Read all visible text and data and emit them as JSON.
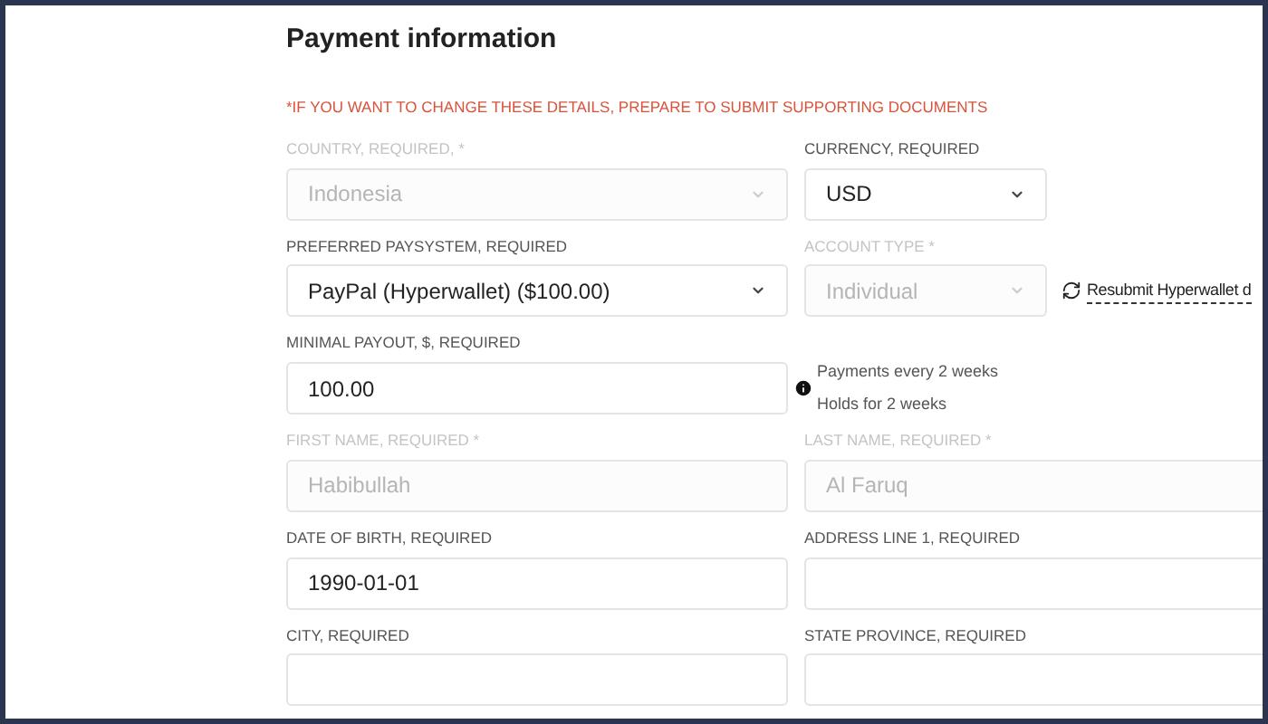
{
  "title": "Payment information",
  "warning": "*IF YOU WANT TO CHANGE THESE DETAILS, PREPARE TO SUBMIT SUPPORTING DOCUMENTS",
  "rows": [
    {
      "fields": [
        {
          "label": "COUNTRY, REQUIRED, *",
          "value": "Indonesia",
          "kind": "select",
          "disabled": true
        },
        {
          "label": "CURRENCY, REQUIRED",
          "value": "USD",
          "kind": "select",
          "disabled": false
        }
      ]
    },
    {
      "fields": [
        {
          "label": "PREFERRED PAYSYSTEM, REQUIRED",
          "value": "PayPal (Hyperwallet) ($100.00)",
          "kind": "select",
          "disabled": false
        },
        {
          "label": "ACCOUNT TYPE *",
          "value": "Individual",
          "kind": "select",
          "disabled": true
        }
      ],
      "link": "Resubmit Hyperwallet d"
    },
    {
      "fields": [
        {
          "label": "MINIMAL PAYOUT, $, REQUIRED",
          "value": "100.00",
          "kind": "input",
          "disabled": false
        }
      ],
      "info": [
        "Payments every 2 weeks",
        "Holds for 2 weeks"
      ]
    },
    {
      "fields": [
        {
          "label": "FIRST NAME, REQUIRED *",
          "value": "Habibullah",
          "kind": "input",
          "disabled": true
        },
        {
          "label": "LAST NAME, REQUIRED *",
          "value": "Al Faruq",
          "kind": "input",
          "disabled": true
        }
      ]
    },
    {
      "fields": [
        {
          "label": "DATE OF BIRTH, REQUIRED",
          "value": "1990-01-01",
          "kind": "input",
          "disabled": false
        },
        {
          "label": "ADDRESS LINE 1, REQUIRED",
          "kind": "input"
        }
      ]
    },
    {
      "fields": [
        {
          "label": "CITY, REQUIRED",
          "kind": "input"
        },
        {
          "label": "STATE PROVINCE, REQUIRED",
          "kind": "input"
        }
      ]
    }
  ]
}
